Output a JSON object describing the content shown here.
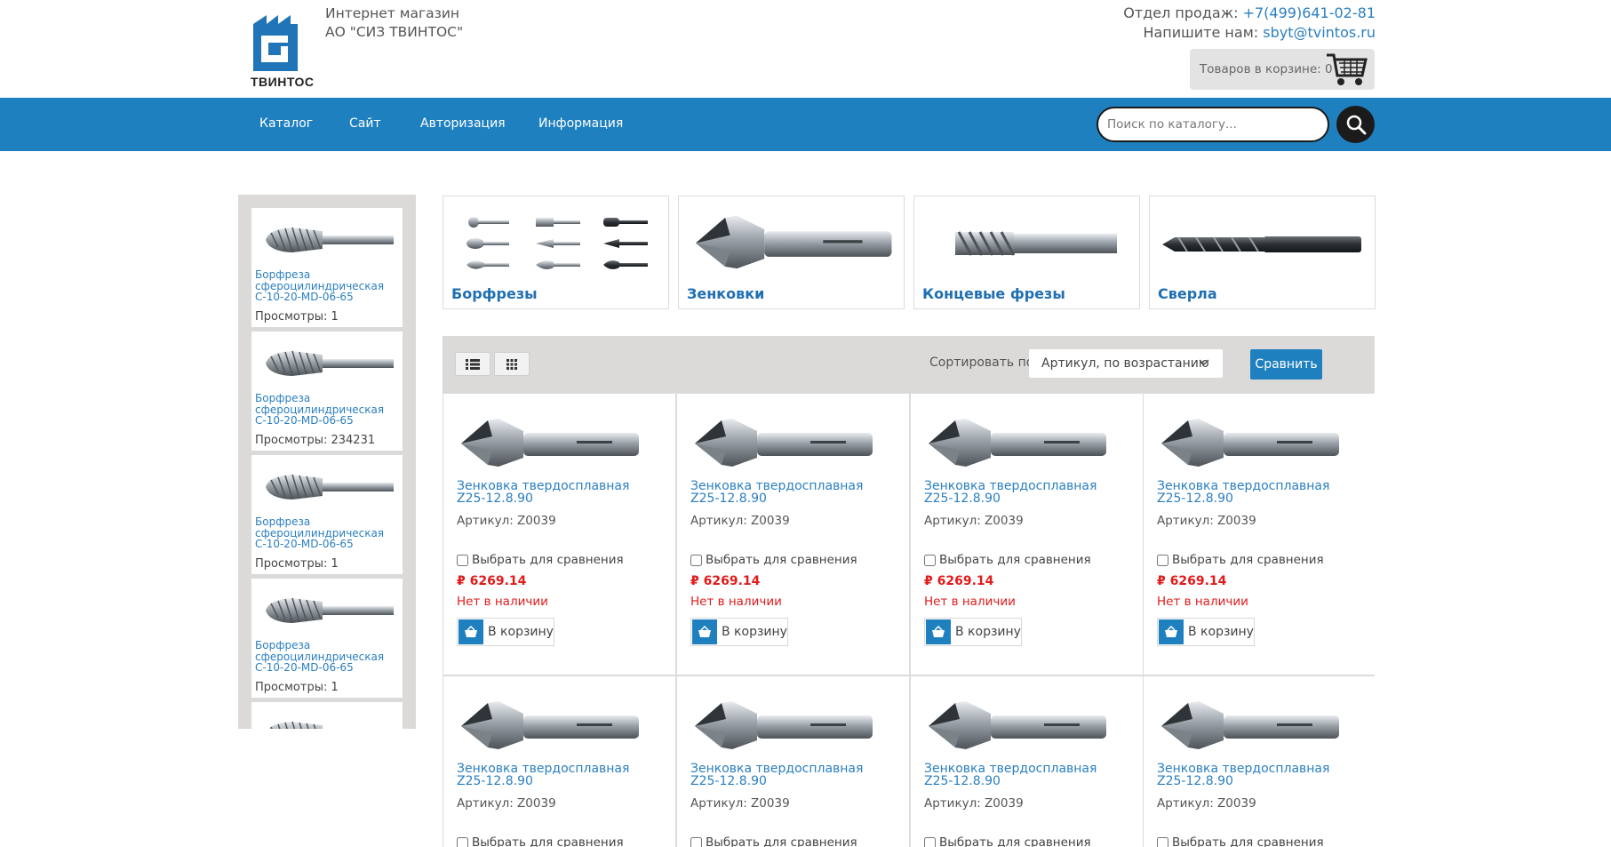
{
  "header": {
    "logo_text": "ТВИНТОС",
    "company_line1": "Интернет магазин",
    "company_line2": "АО \"СИЗ ТВИНТОС\"",
    "sales_label": "Отдел продаж: ",
    "sales_phone": "+7(499)641-02-81",
    "email_label": "Напишите нам: ",
    "email": "sbyt@tvintos.ru",
    "cart_label": "Товаров в корзине: 0"
  },
  "nav": {
    "items": [
      "Каталог",
      "Сайт",
      "Авторизация",
      "Информация"
    ],
    "search_placeholder": "Поиск по каталогу..."
  },
  "sidebar": {
    "items": [
      {
        "name": "Борфреза сфероцилиндрическая C-10-20-MD-06-65",
        "views": "Просмотры: 1"
      },
      {
        "name": "Борфреза сфероцилиндрическая C-10-20-MD-06-65",
        "views": "Просмотры: 234231"
      },
      {
        "name": "Борфреза сфероцилиндрическая C-10-20-MD-06-65",
        "views": "Просмотры: 1"
      },
      {
        "name": "Борфреза сфероцилиндрическая C-10-20-MD-06-65",
        "views": "Просмотры: 1"
      }
    ]
  },
  "categories": [
    "Борфрезы",
    "Зенковки",
    "Концевые фрезы",
    "Сверла"
  ],
  "toolbar": {
    "sort_label": "Сортировать по",
    "sort_value": "Артикул, по возрастанию",
    "compare_label": "Сравнить"
  },
  "products": [
    {
      "name": "Зенковка твердосплавная Z25-12.8.90",
      "sku": "Артикул: Z0039",
      "compare": "Выбрать для сравнения",
      "price": "₽ 6269.14",
      "stock": "Нет в наличии",
      "cart": "В корзину"
    },
    {
      "name": "Зенковка твердосплавная Z25-12.8.90",
      "sku": "Артикул: Z0039",
      "compare": "Выбрать для сравнения",
      "price": "₽ 6269.14",
      "stock": "Нет в наличии",
      "cart": "В корзину"
    },
    {
      "name": "Зенковка твердосплавная Z25-12.8.90",
      "sku": "Артикул: Z0039",
      "compare": "Выбрать для сравнения",
      "price": "₽ 6269.14",
      "stock": "Нет в наличии",
      "cart": "В корзину"
    },
    {
      "name": "Зенковка твердосплавная Z25-12.8.90",
      "sku": "Артикул: Z0039",
      "compare": "Выбрать для сравнения",
      "price": "₽ 6269.14",
      "stock": "Нет в наличии",
      "cart": "В корзину"
    },
    {
      "name": "Зенковка твердосплавная Z25-12.8.90",
      "sku": "Артикул: Z0039",
      "compare": "Выбрать для сравнения",
      "price": "",
      "stock": "",
      "cart": ""
    },
    {
      "name": "Зенковка твердосплавная Z25-12.8.90",
      "sku": "Артикул: Z0039",
      "compare": "Выбрать для сравнения",
      "price": "",
      "stock": "",
      "cart": ""
    },
    {
      "name": "Зенковка твердосплавная Z25-12.8.90",
      "sku": "Артикул: Z0039",
      "compare": "Выбрать для сравнения",
      "price": "",
      "stock": "",
      "cart": ""
    },
    {
      "name": "Зенковка твердосплавная Z25-12.8.90",
      "sku": "Артикул: Z0039",
      "compare": "Выбрать для сравнения",
      "price": "",
      "stock": "",
      "cart": ""
    }
  ],
  "icons": {
    "logo": "factory-logo-icon",
    "cart": "shopping-cart-icon",
    "search": "search-icon",
    "list_view": "list-view-icon",
    "grid_view": "grid-view-icon",
    "basket": "basket-icon"
  },
  "colors": {
    "primary": "#1f80c0",
    "link": "#2a7fc1",
    "price": "#e21b1b"
  }
}
